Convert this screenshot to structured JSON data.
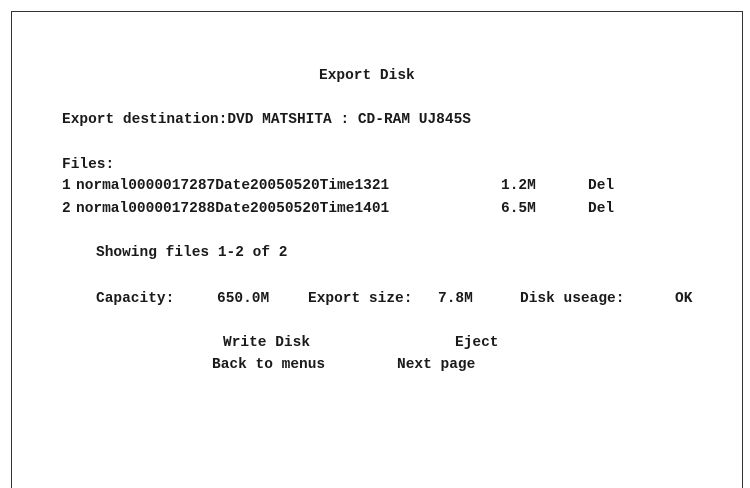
{
  "title": "Export Disk",
  "destination": {
    "label": "Export destination:",
    "value": "DVD MATSHITA : CD-RAM UJ845S"
  },
  "files_label": "Files:",
  "files": [
    {
      "index": "1",
      "name": "normal0000017287Date20050520Time1321",
      "size": "1.2M",
      "action": "Del"
    },
    {
      "index": "2",
      "name": "normal0000017288Date20050520Time1401",
      "size": "6.5M",
      "action": "Del"
    }
  ],
  "showing": "Showing files 1-2 of 2",
  "capacity": {
    "capacity_label": "Capacity:",
    "capacity_value": "650.0M",
    "export_label": "Export size:",
    "export_value": "7.8M",
    "usage_label": "Disk useage:",
    "usage_value": "OK"
  },
  "buttons": {
    "write_disk": "Write Disk",
    "eject": "Eject",
    "back_to_menus": "Back to menus",
    "next_page": "Next page"
  }
}
